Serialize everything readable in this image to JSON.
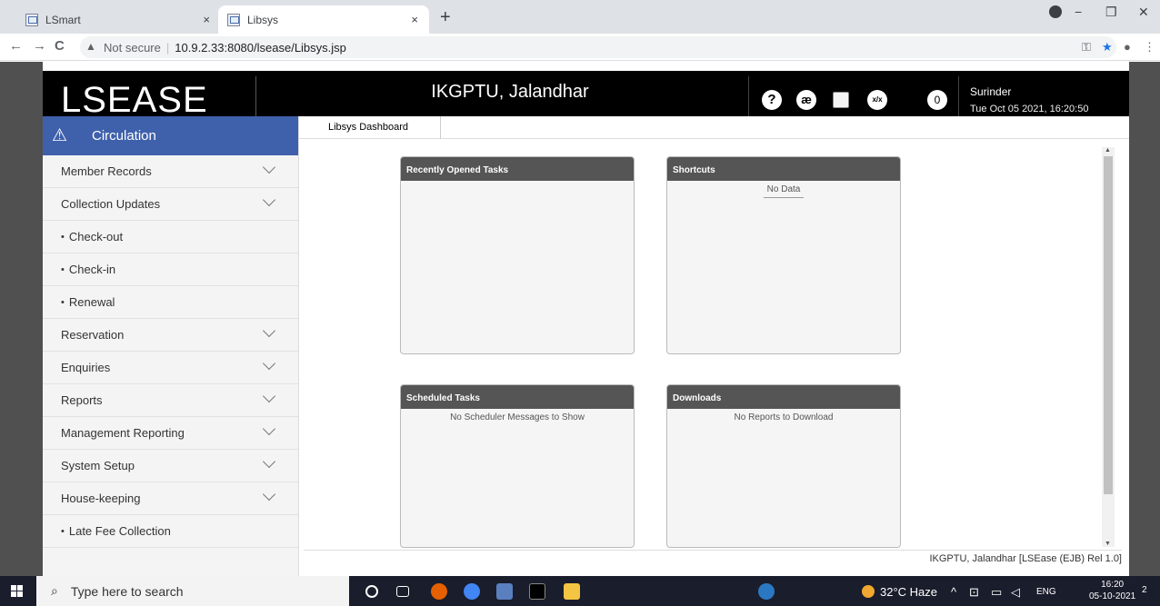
{
  "browser": {
    "tabs": [
      {
        "title": "LSmart"
      },
      {
        "title": "Libsys"
      }
    ],
    "new_tab": "+",
    "tab_close": "×",
    "window_controls": {
      "minimize": "−",
      "maximize": "❐",
      "close": "✕"
    },
    "nav": {
      "back": "←",
      "forward": "→",
      "reload": "C"
    },
    "security_text": "Not secure",
    "url": "10.9.2.33:8080/lsease/Libsys.jsp"
  },
  "app": {
    "logo_text": "LSEASE",
    "institution": "IKGPTU, Jalandhar",
    "header_icons": [
      {
        "name": "help-icon",
        "glyph": "?"
      },
      {
        "name": "language-icon",
        "glyph": "æ"
      },
      {
        "name": "broken-image-icon",
        "glyph": ""
      },
      {
        "name": "calculator-icon",
        "glyph": "x/x"
      },
      {
        "name": "notification-count",
        "glyph": "0"
      }
    ],
    "user": {
      "name": "Surinder",
      "datetime": "Tue Oct 05 2021, 16:20:50"
    }
  },
  "sidebar": {
    "header": "Circulation",
    "items": [
      {
        "label": "Member Records",
        "expandable": true
      },
      {
        "label": "Collection Updates",
        "expandable": true
      },
      {
        "label": "Check-out",
        "sub": true
      },
      {
        "label": "Check-in",
        "sub": true
      },
      {
        "label": "Renewal",
        "sub": true
      },
      {
        "label": "Reservation",
        "expandable": true
      },
      {
        "label": "Enquiries",
        "expandable": true
      },
      {
        "label": "Reports",
        "expandable": true
      },
      {
        "label": "Management Reporting",
        "expandable": true
      },
      {
        "label": "System Setup",
        "expandable": true
      },
      {
        "label": "House-keeping",
        "expandable": true
      },
      {
        "label": "Late Fee Collection",
        "sub": true
      }
    ]
  },
  "main": {
    "tab_label": "Libsys Dashboard",
    "panels": {
      "recent": {
        "title": "Recently Opened Tasks",
        "message": ""
      },
      "shortcuts": {
        "title": "Shortcuts",
        "message": "No Data"
      },
      "scheduled": {
        "title": "Scheduled Tasks",
        "message": "No Scheduler Messages to Show"
      },
      "downloads": {
        "title": "Downloads",
        "message": "No Reports to Download"
      }
    },
    "footer": "IKGPTU, Jalandhar [LSEase (EJB) Rel 1.0]"
  },
  "taskbar": {
    "search_placeholder": "Type here to search",
    "weather": "32°C  Haze",
    "language": "ENG",
    "time": "16:20",
    "date": "05-10-2021",
    "notification_count": "2"
  },
  "colors": {
    "sidebar_header": "#3f61ab",
    "header_bg": "#000000",
    "panel_header": "#555555",
    "taskbar_bg": "#1a1d2b"
  }
}
